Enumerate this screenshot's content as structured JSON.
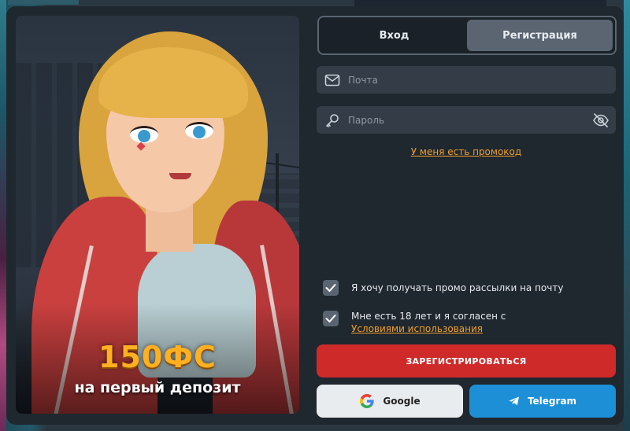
{
  "tabs": [
    {
      "label": "Вход",
      "active": false
    },
    {
      "label": "Регистрация",
      "active": true
    }
  ],
  "form": {
    "email_placeholder": "Почта",
    "password_placeholder": "Пароль",
    "promo_link": "У меня есть промокод",
    "checkbox_promo_label": "Я хочу получать промо рассылки на почту",
    "checkbox_age_label": "Мне есть 18 лет и я согласен с",
    "terms_link": "Условиями использования",
    "register_button": "ЗАРЕГИСТРИРОВАТЬСЯ",
    "google_button": "Google",
    "telegram_button": "Telegram"
  },
  "promo": {
    "amount": "150ФС",
    "subtitle": "на первый депозит"
  },
  "colors": {
    "accent_orange": "#f0a12a",
    "register_red": "#cf2a2a",
    "telegram_blue": "#1d8fd6",
    "modal_bg": "#1f272f",
    "field_bg": "#343d47"
  },
  "icons": [
    "mail-icon",
    "key-icon",
    "eye-off-icon",
    "check-icon",
    "google-icon",
    "telegram-icon"
  ]
}
